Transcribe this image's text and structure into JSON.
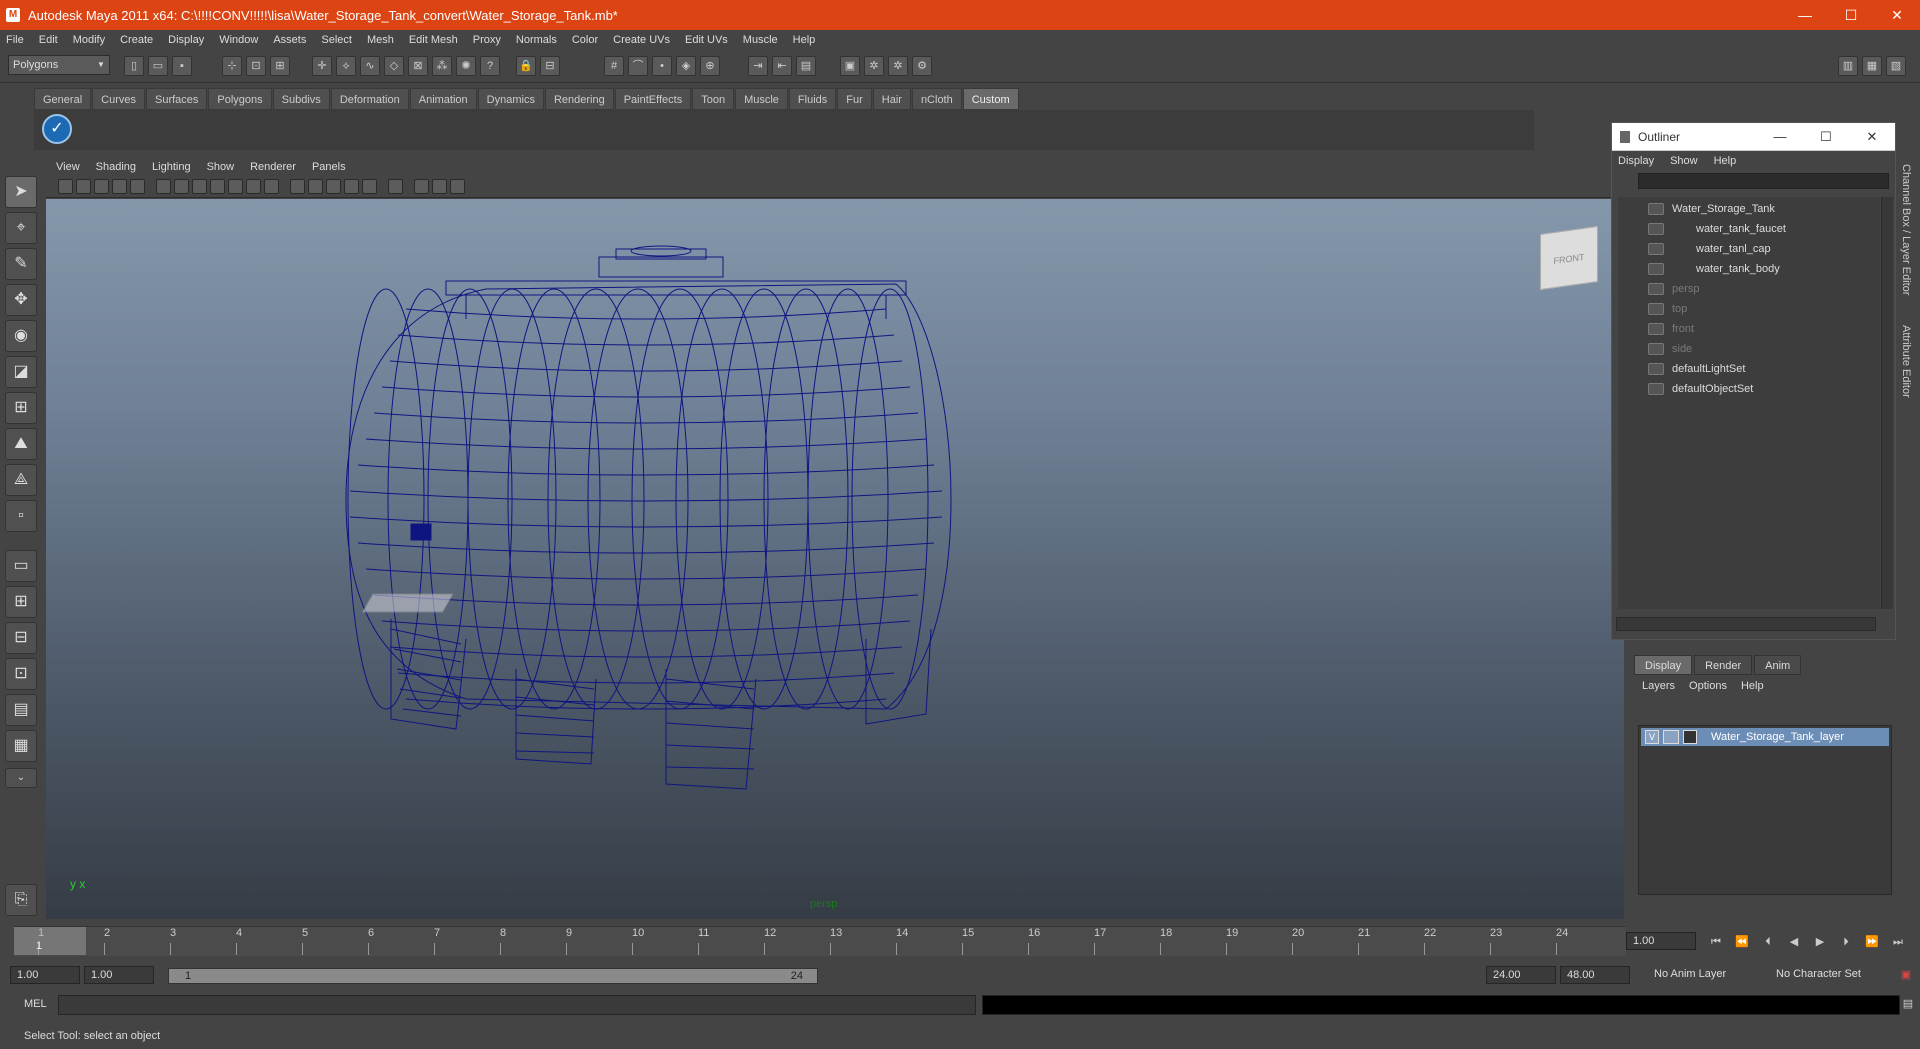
{
  "window": {
    "title": "Autodesk Maya 2011 x64: C:\\!!!!CONV!!!!!\\lisa\\Water_Storage_Tank_convert\\Water_Storage_Tank.mb*",
    "min": "—",
    "max": "☐",
    "close": "✕"
  },
  "menubar": [
    "File",
    "Edit",
    "Modify",
    "Create",
    "Display",
    "Window",
    "Assets",
    "Select",
    "Mesh",
    "Edit Mesh",
    "Proxy",
    "Normals",
    "Color",
    "Create UVs",
    "Edit UVs",
    "Muscle",
    "Help"
  ],
  "mode_selector": "Polygons",
  "shelf_tabs": [
    "General",
    "Curves",
    "Surfaces",
    "Polygons",
    "Subdivs",
    "Deformation",
    "Animation",
    "Dynamics",
    "Rendering",
    "PaintEffects",
    "Toon",
    "Muscle",
    "Fluids",
    "Fur",
    "Hair",
    "nCloth",
    "Custom"
  ],
  "viewport": {
    "menu": [
      "View",
      "Shading",
      "Lighting",
      "Show",
      "Renderer",
      "Panels"
    ],
    "camera_label": "persp",
    "viewcube_label": "FRONT",
    "axis_label": "y x",
    "wire_color": "#0f1580"
  },
  "outliner": {
    "title": "Outliner",
    "menu": [
      "Display",
      "Show",
      "Help"
    ],
    "items": [
      {
        "label": "Water_Storage_Tank",
        "dim": false
      },
      {
        "label": "water_tank_faucet",
        "dim": false
      },
      {
        "label": "water_tanl_cap",
        "dim": false
      },
      {
        "label": "water_tank_body",
        "dim": false
      },
      {
        "label": "persp",
        "dim": true
      },
      {
        "label": "top",
        "dim": true
      },
      {
        "label": "front",
        "dim": true
      },
      {
        "label": "side",
        "dim": true
      },
      {
        "label": "defaultLightSet",
        "dim": false
      },
      {
        "label": "defaultObjectSet",
        "dim": false
      }
    ]
  },
  "right_tabs": [
    "Channel Box / Layer Editor",
    "Attribute Editor"
  ],
  "layer_editor": {
    "tabs": [
      "Display",
      "Render",
      "Anim"
    ],
    "menu": [
      "Layers",
      "Options",
      "Help"
    ],
    "layer_visible": "V",
    "layer_name": "Water_Storage_Tank_layer"
  },
  "timeline": {
    "ticks": [
      "1",
      "2",
      "3",
      "4",
      "5",
      "6",
      "7",
      "8",
      "9",
      "10",
      "11",
      "12",
      "13",
      "14",
      "15",
      "16",
      "17",
      "18",
      "19",
      "20",
      "21",
      "22",
      "23",
      "24"
    ],
    "current_frame": "1",
    "current_time_field": "1.00"
  },
  "range": {
    "start_time": "1.00",
    "playback_start": "1.00",
    "slider_start": "1",
    "slider_end": "24",
    "playback_end": "24.00",
    "end_time": "48.00",
    "anim_layer": "No Anim Layer",
    "character_set": "No Character Set"
  },
  "mel": {
    "label": "MEL"
  },
  "status": "Select Tool: select an object"
}
